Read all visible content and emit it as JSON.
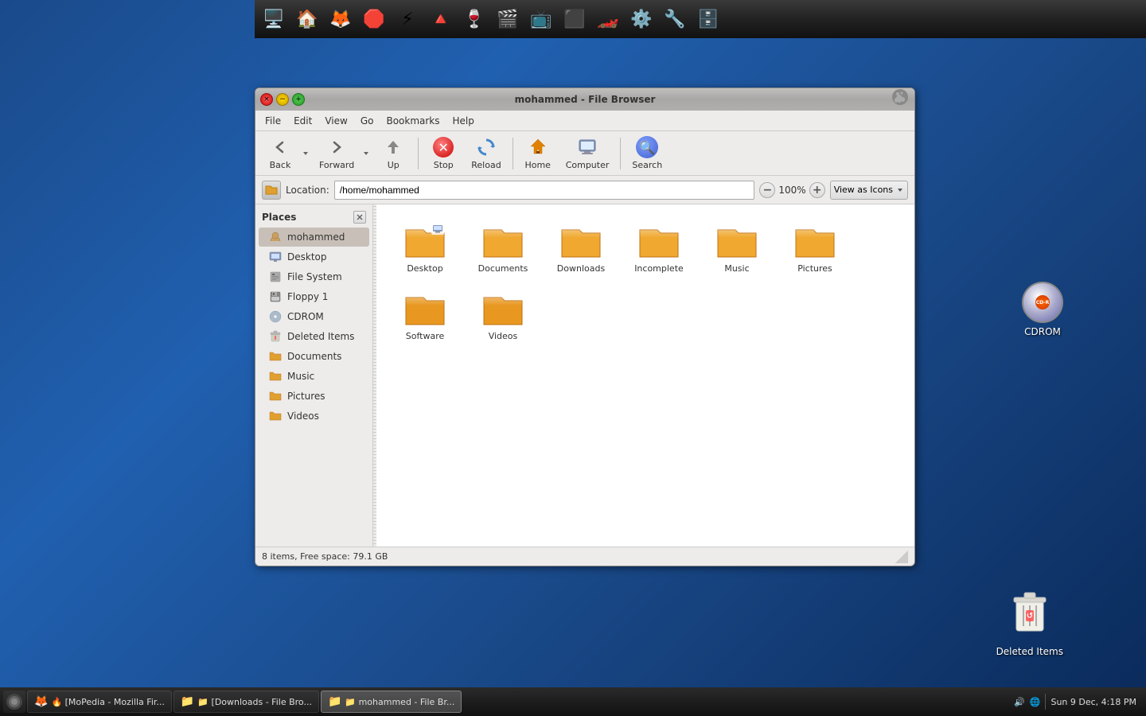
{
  "desktop": {
    "background": "blue gradient"
  },
  "taskbar_top": {
    "icons": [
      {
        "name": "computer-icon",
        "symbol": "🖥️"
      },
      {
        "name": "home-folder-icon",
        "symbol": "🏠"
      },
      {
        "name": "firefox-icon",
        "symbol": "🦊"
      },
      {
        "name": "stop-button-icon",
        "symbol": "🛑"
      },
      {
        "name": "kde-icon",
        "symbol": "⚡"
      },
      {
        "name": "torrent-icon",
        "symbol": "🔺"
      },
      {
        "name": "wine-icon",
        "symbol": "🍷"
      },
      {
        "name": "video-icon",
        "symbol": "🎬"
      },
      {
        "name": "media-icon",
        "symbol": "📺"
      },
      {
        "name": "terminal-icon",
        "symbol": "⬛"
      },
      {
        "name": "browser2-icon",
        "symbol": "🏎️"
      },
      {
        "name": "settings-icon",
        "symbol": "⚙️"
      },
      {
        "name": "tools-icon",
        "symbol": "🔧"
      },
      {
        "name": "db-icon",
        "symbol": "🗄️"
      }
    ]
  },
  "window": {
    "title": "mohammed - File Browser",
    "buttons": {
      "close": "×",
      "minimize": "−",
      "maximize": "+"
    }
  },
  "menubar": {
    "items": [
      "File",
      "Edit",
      "View",
      "Go",
      "Bookmarks",
      "Help"
    ]
  },
  "toolbar": {
    "back_label": "Back",
    "forward_label": "Forward",
    "up_label": "Up",
    "stop_label": "Stop",
    "reload_label": "Reload",
    "home_label": "Home",
    "computer_label": "Computer",
    "search_label": "Search"
  },
  "locationbar": {
    "label": "Location:",
    "path": "/home/mohammed",
    "zoom": "100%",
    "view_mode": "View as Icons"
  },
  "sidebar": {
    "header": "Places",
    "items": [
      {
        "name": "mohammed",
        "icon": "👤",
        "type": "user"
      },
      {
        "name": "Desktop",
        "icon": "🖥️",
        "type": "desktop"
      },
      {
        "name": "File System",
        "icon": "💾",
        "type": "filesystem"
      },
      {
        "name": "Floppy 1",
        "icon": "💾",
        "type": "floppy"
      },
      {
        "name": "CDROM",
        "icon": "💿",
        "type": "cdrom"
      },
      {
        "name": "Deleted Items",
        "icon": "🗑️",
        "type": "trash"
      },
      {
        "name": "Documents",
        "icon": "📁",
        "type": "folder"
      },
      {
        "name": "Music",
        "icon": "📁",
        "type": "folder"
      },
      {
        "name": "Pictures",
        "icon": "📁",
        "type": "folder"
      },
      {
        "name": "Videos",
        "icon": "📁",
        "type": "folder"
      }
    ]
  },
  "folders": [
    {
      "name": "Desktop",
      "has_overlay": true
    },
    {
      "name": "Documents",
      "has_overlay": false
    },
    {
      "name": "Downloads",
      "has_overlay": false
    },
    {
      "name": "Incomplete",
      "has_overlay": false
    },
    {
      "name": "Music",
      "has_overlay": false
    },
    {
      "name": "Pictures",
      "has_overlay": false
    },
    {
      "name": "Software",
      "has_overlay": false
    },
    {
      "name": "Videos",
      "has_overlay": false
    }
  ],
  "statusbar": {
    "text": "8 items, Free space: 79.1 GB"
  },
  "cdrom_desktop": {
    "label": "CDROM"
  },
  "trash_desktop": {
    "label": "Deleted Items"
  },
  "taskbar_bottom": {
    "items": [
      {
        "label": "🔥 [MoPedia - Mozilla Fir...",
        "active": false
      },
      {
        "label": "📁 [Downloads - File Bro...",
        "active": false
      },
      {
        "label": "📁 mohammed - File Br...",
        "active": true
      }
    ],
    "system_tray": {
      "volume": "🔊",
      "network": "🌐",
      "time": "Sun 9 Dec, 4:18 PM"
    }
  }
}
